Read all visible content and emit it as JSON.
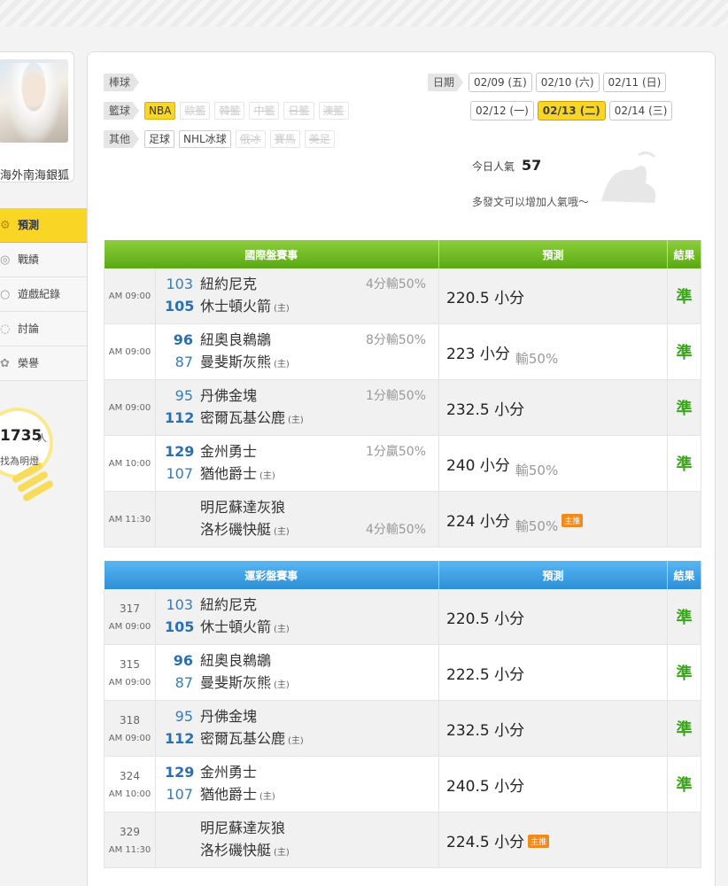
{
  "sidebar": {
    "user_name": "海外南海銀狐",
    "menu": [
      {
        "label": "預測",
        "icon": "gear-icon",
        "active": true
      },
      {
        "label": "戰績",
        "icon": "chart-icon",
        "active": false
      },
      {
        "label": "遊戲紀錄",
        "icon": "record-icon",
        "active": false
      },
      {
        "label": "討論",
        "icon": "chat-icon",
        "active": false
      },
      {
        "label": "榮譽",
        "icon": "medal-icon",
        "active": false
      }
    ],
    "fans": {
      "count": "1735",
      "unit": "人",
      "text": "找為明燈"
    }
  },
  "sports": {
    "baseball": "棒球",
    "basketball": "籃球",
    "basketball_leagues": [
      {
        "label": "NBA",
        "state": "on"
      },
      {
        "label": "歐籃",
        "state": "off"
      },
      {
        "label": "韓籃",
        "state": "off"
      },
      {
        "label": "中籃",
        "state": "off"
      },
      {
        "label": "日籃",
        "state": "off"
      },
      {
        "label": "澳籃",
        "state": "off"
      }
    ],
    "other": "其他",
    "other_leagues": [
      {
        "label": "足球",
        "state": "normal"
      },
      {
        "label": "NHL冰球",
        "state": "normal"
      },
      {
        "label": "俄冰",
        "state": "off"
      },
      {
        "label": "賽馬",
        "state": "off"
      },
      {
        "label": "美足",
        "state": "off"
      }
    ]
  },
  "dates": {
    "label": "日期",
    "row1": [
      {
        "label": "02/09 (五)",
        "selected": false
      },
      {
        "label": "02/10 (六)",
        "selected": false
      },
      {
        "label": "02/11 (日)",
        "selected": false
      }
    ],
    "row2": [
      {
        "label": "02/12 (一)",
        "selected": false
      },
      {
        "label": "02/13 (二)",
        "selected": true
      },
      {
        "label": "02/14 (三)",
        "selected": false
      }
    ]
  },
  "popularity": {
    "label": "今日人氣",
    "value": "57",
    "hint": "多發文可以增加人氣哦～"
  },
  "intl_table": {
    "headers": [
      "國際盤賽事",
      "預測",
      "結果"
    ],
    "rows": [
      {
        "num": "",
        "time": "AM 09:00",
        "s1": "103",
        "w1": false,
        "t1": "紐約尼克",
        "s2": "105",
        "w2": true,
        "t2": "休士頓火箭",
        "host": "(主)",
        "odds1": "4分輸50%",
        "odds2": "",
        "pred": "220.5 小分",
        "pred_sub": "",
        "badge": "",
        "result": "準"
      },
      {
        "num": "",
        "time": "AM 09:00",
        "s1": "96",
        "w1": true,
        "t1": "紐奧良鵜鶘",
        "s2": "87",
        "w2": false,
        "t2": "曼斐斯灰熊",
        "host": "(主)",
        "odds1": "8分輸50%",
        "odds2": "",
        "pred": "223 小分",
        "pred_sub": "輸50%",
        "badge": "",
        "result": "準"
      },
      {
        "num": "",
        "time": "AM 09:00",
        "s1": "95",
        "w1": false,
        "t1": "丹佛金塊",
        "s2": "112",
        "w2": true,
        "t2": "密爾瓦基公鹿",
        "host": "(主)",
        "odds1": "1分輸50%",
        "odds2": "",
        "pred": "232.5 小分",
        "pred_sub": "",
        "badge": "",
        "result": "準"
      },
      {
        "num": "",
        "time": "AM 10:00",
        "s1": "129",
        "w1": true,
        "t1": "金州勇士",
        "s2": "107",
        "w2": false,
        "t2": "猶他爵士",
        "host": "(主)",
        "odds1": "1分贏50%",
        "odds2": "",
        "pred": "240 小分",
        "pred_sub": "輸50%",
        "badge": "",
        "result": "準"
      },
      {
        "num": "",
        "time": "AM 11:30",
        "s1": "",
        "w1": false,
        "t1": "明尼蘇達灰狼",
        "s2": "",
        "w2": false,
        "t2": "洛杉磯快艇",
        "host": "(主)",
        "odds1": "",
        "odds2": "4分輸50%",
        "pred": "224 小分",
        "pred_sub": "輸50%",
        "badge": "主推",
        "result": ""
      }
    ]
  },
  "lottery_table": {
    "headers": [
      "運彩盤賽事",
      "預測",
      "結果"
    ],
    "rows": [
      {
        "num": "317",
        "time": "AM 09:00",
        "s1": "103",
        "w1": false,
        "t1": "紐約尼克",
        "s2": "105",
        "w2": true,
        "t2": "休士頓火箭",
        "host": "(主)",
        "odds1": "",
        "odds2": "",
        "pred": "220.5 小分",
        "pred_sub": "",
        "badge": "",
        "result": "準"
      },
      {
        "num": "315",
        "time": "AM 09:00",
        "s1": "96",
        "w1": true,
        "t1": "紐奧良鵜鶘",
        "s2": "87",
        "w2": false,
        "t2": "曼斐斯灰熊",
        "host": "(主)",
        "odds1": "",
        "odds2": "",
        "pred": "222.5 小分",
        "pred_sub": "",
        "badge": "",
        "result": "準"
      },
      {
        "num": "318",
        "time": "AM 09:00",
        "s1": "95",
        "w1": false,
        "t1": "丹佛金塊",
        "s2": "112",
        "w2": true,
        "t2": "密爾瓦基公鹿",
        "host": "(主)",
        "odds1": "",
        "odds2": "",
        "pred": "232.5 小分",
        "pred_sub": "",
        "badge": "",
        "result": "準"
      },
      {
        "num": "324",
        "time": "AM 10:00",
        "s1": "129",
        "w1": true,
        "t1": "金州勇士",
        "s2": "107",
        "w2": false,
        "t2": "猶他爵士",
        "host": "(主)",
        "odds1": "",
        "odds2": "",
        "pred": "240.5 小分",
        "pred_sub": "",
        "badge": "",
        "result": "準"
      },
      {
        "num": "329",
        "time": "AM 11:30",
        "s1": "",
        "w1": false,
        "t1": "明尼蘇達灰狼",
        "s2": "",
        "w2": false,
        "t2": "洛杉磯快艇",
        "host": "(主)",
        "odds1": "",
        "odds2": "",
        "pred": "224.5 小分",
        "pred_sub": "",
        "badge": "主推",
        "result": ""
      }
    ]
  },
  "colors": {
    "accent": "#f9d626",
    "intl_header": "#6ab927",
    "lottery_header": "#3a9de3",
    "result": "#3aa51a",
    "score": "#2f7fc1"
  }
}
